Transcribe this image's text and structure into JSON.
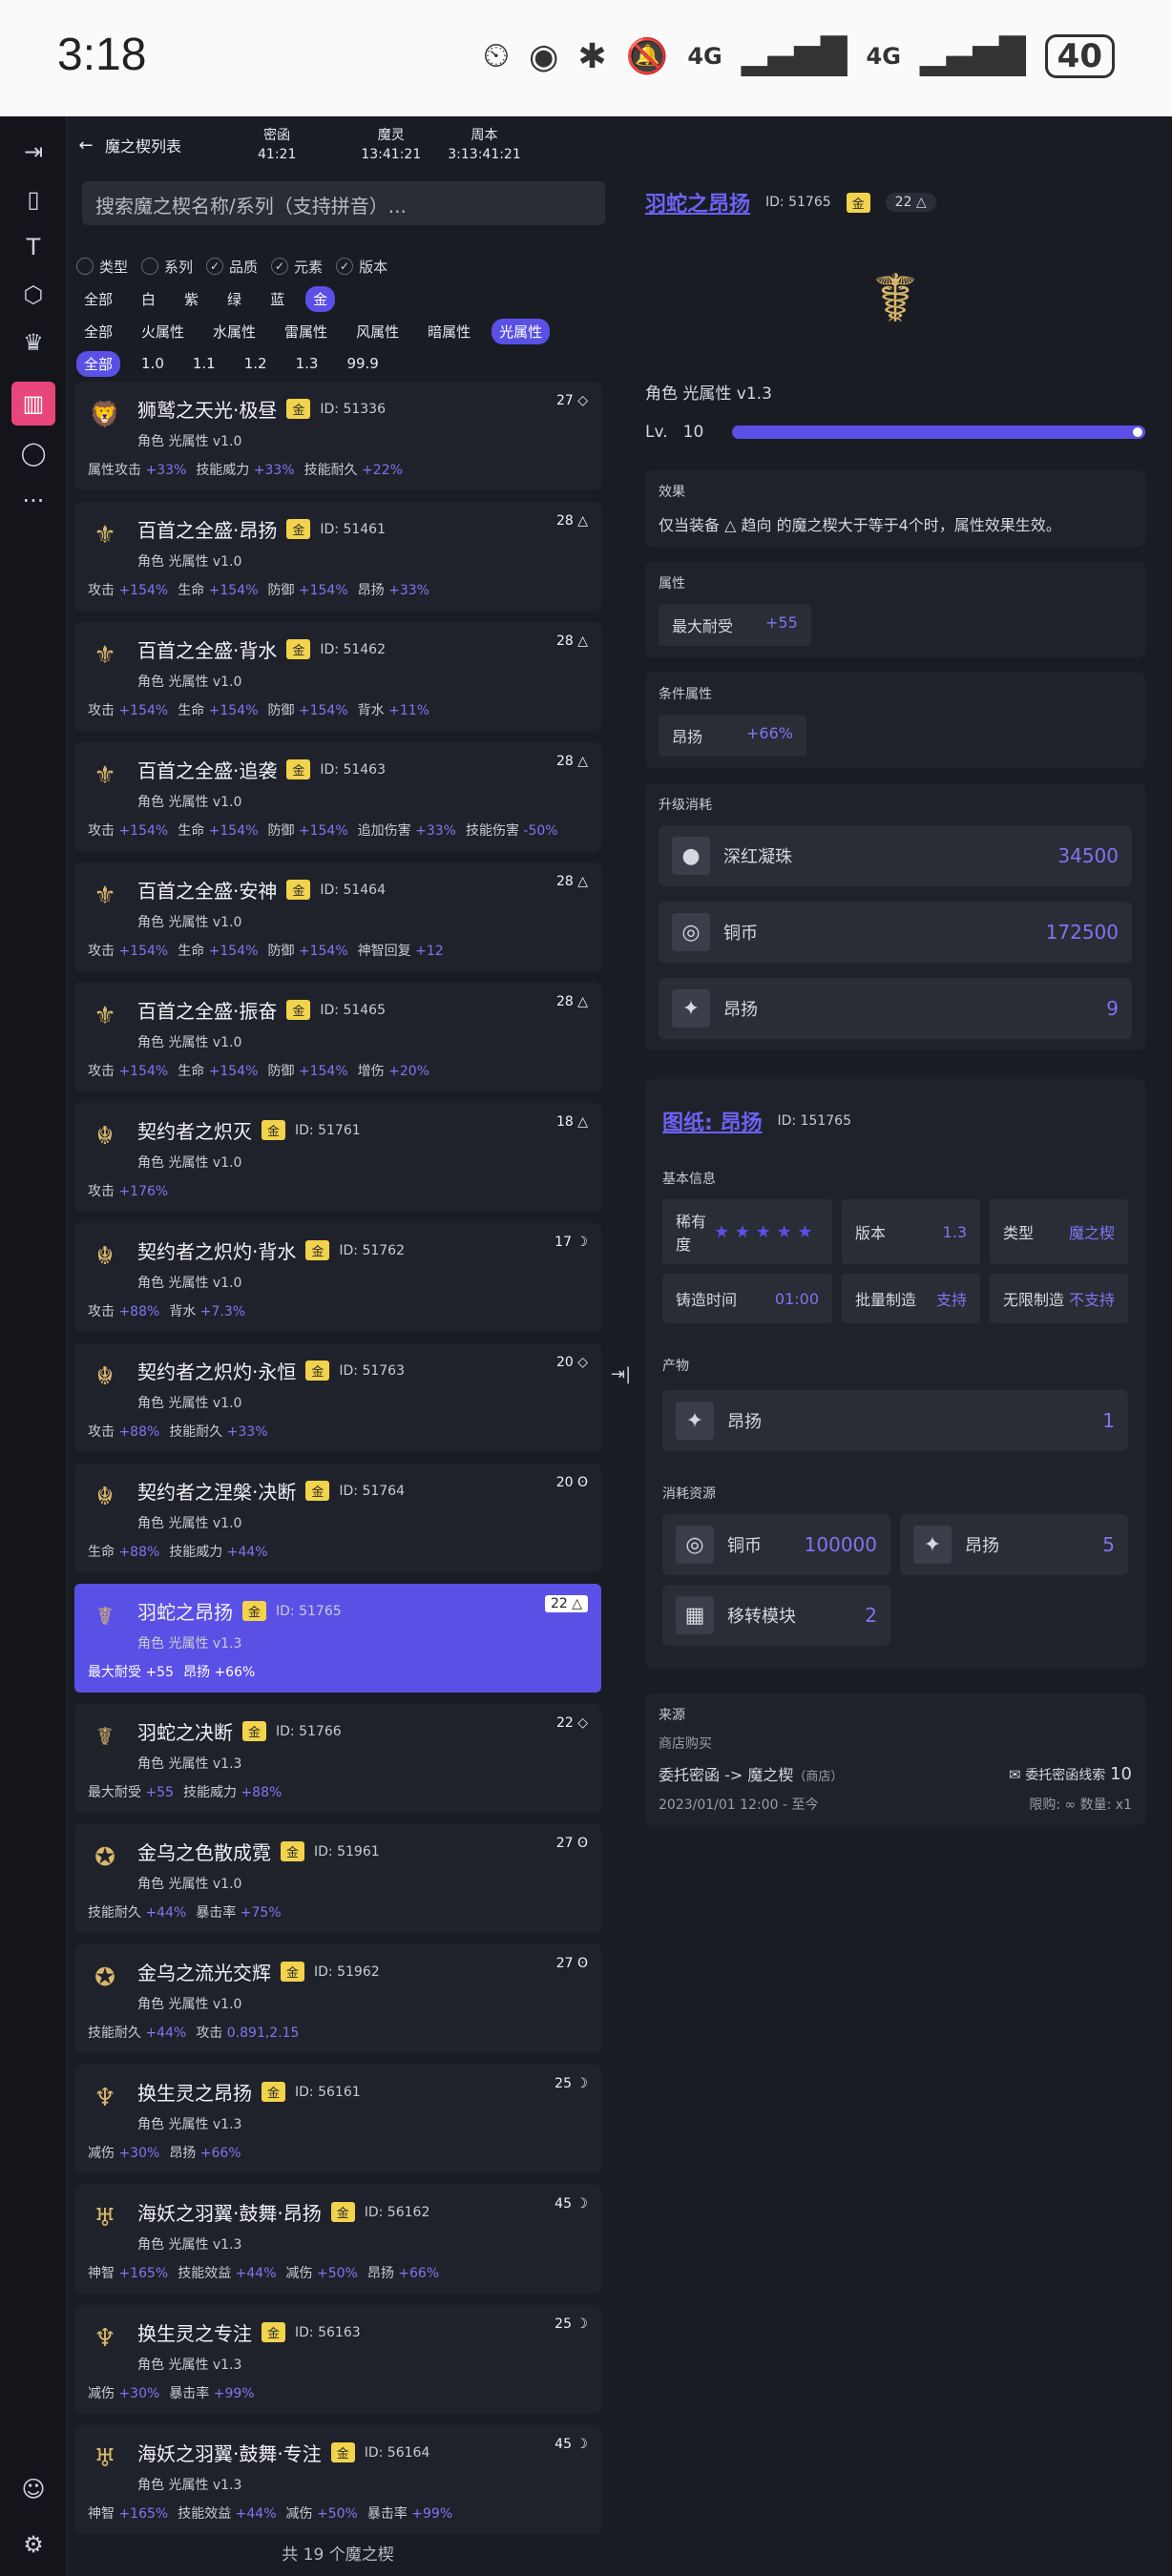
{
  "status": {
    "time": "3:18",
    "net1": "4G",
    "net2": "4G",
    "battery": "40"
  },
  "header": {
    "back": "←",
    "title": "魔之楔列表",
    "timers": [
      {
        "label": "密函",
        "value": "41:21"
      },
      {
        "label": "魔灵",
        "value": "13:41:21"
      },
      {
        "label": "周本",
        "value": "3:13:41:21"
      }
    ]
  },
  "search": {
    "placeholder": "搜索魔之楔名称/系列（支持拼音）..."
  },
  "filters": {
    "checks": [
      {
        "label": "类型",
        "on": false
      },
      {
        "label": "系列",
        "on": false
      },
      {
        "label": "品质",
        "on": true
      },
      {
        "label": "元素",
        "on": true
      },
      {
        "label": "版本",
        "on": true
      }
    ],
    "quality": [
      "全部",
      "白",
      "紫",
      "绿",
      "蓝",
      "金"
    ],
    "quality_sel": "金",
    "element": [
      "全部",
      "火属性",
      "水属性",
      "雷属性",
      "风属性",
      "暗属性",
      "光属性"
    ],
    "element_sel": "光属性",
    "version": [
      "全部",
      "1.0",
      "1.1",
      "1.2",
      "1.3",
      "99.9"
    ],
    "version_sel": "全部"
  },
  "list": [
    {
      "name": "狮鹫之天光·极昼",
      "q": "金",
      "id": "ID: 51336",
      "lv": "27 ◇",
      "meta": "角色  光属性  v1.0",
      "stats": [
        [
          "属性攻击",
          "+33%"
        ],
        [
          "技能威力",
          "+33%"
        ],
        [
          "技能耐久",
          "+22%"
        ]
      ]
    },
    {
      "name": "百首之全盛·昂扬",
      "q": "金",
      "id": "ID: 51461",
      "lv": "28 △",
      "meta": "角色  光属性  v1.0",
      "stats": [
        [
          "攻击",
          "+154%"
        ],
        [
          "生命",
          "+154%"
        ],
        [
          "防御",
          "+154%"
        ],
        [
          "昂扬",
          "+33%"
        ]
      ]
    },
    {
      "name": "百首之全盛·背水",
      "q": "金",
      "id": "ID: 51462",
      "lv": "28 △",
      "meta": "角色  光属性  v1.0",
      "stats": [
        [
          "攻击",
          "+154%"
        ],
        [
          "生命",
          "+154%"
        ],
        [
          "防御",
          "+154%"
        ],
        [
          "背水",
          "+11%"
        ]
      ]
    },
    {
      "name": "百首之全盛·追袭",
      "q": "金",
      "id": "ID: 51463",
      "lv": "28 △",
      "meta": "角色  光属性  v1.0",
      "stats": [
        [
          "攻击",
          "+154%"
        ],
        [
          "生命",
          "+154%"
        ],
        [
          "防御",
          "+154%"
        ],
        [
          "追加伤害",
          "+33%"
        ],
        [
          "技能伤害",
          "-50%"
        ]
      ]
    },
    {
      "name": "百首之全盛·安神",
      "q": "金",
      "id": "ID: 51464",
      "lv": "28 △",
      "meta": "角色  光属性  v1.0",
      "stats": [
        [
          "攻击",
          "+154%"
        ],
        [
          "生命",
          "+154%"
        ],
        [
          "防御",
          "+154%"
        ],
        [
          "神智回复",
          "+12"
        ]
      ]
    },
    {
      "name": "百首之全盛·振奋",
      "q": "金",
      "id": "ID: 51465",
      "lv": "28 △",
      "meta": "角色  光属性  v1.0",
      "stats": [
        [
          "攻击",
          "+154%"
        ],
        [
          "生命",
          "+154%"
        ],
        [
          "防御",
          "+154%"
        ],
        [
          "增伤",
          "+20%"
        ]
      ]
    },
    {
      "name": "契约者之炽灭",
      "q": "金",
      "id": "ID: 51761",
      "lv": "18 △",
      "meta": "角色  光属性  v1.0",
      "stats": [
        [
          "攻击",
          "+176%"
        ]
      ]
    },
    {
      "name": "契约者之炽灼·背水",
      "q": "金",
      "id": "ID: 51762",
      "lv": "17 ☽",
      "meta": "角色  光属性  v1.0",
      "stats": [
        [
          "攻击",
          "+88%"
        ],
        [
          "背水",
          "+7.3%"
        ]
      ]
    },
    {
      "name": "契约者之炽灼·永恒",
      "q": "金",
      "id": "ID: 51763",
      "lv": "20 ◇",
      "meta": "角色  光属性  v1.0",
      "stats": [
        [
          "攻击",
          "+88%"
        ],
        [
          "技能耐久",
          "+33%"
        ]
      ]
    },
    {
      "name": "契约者之涅槃·决断",
      "q": "金",
      "id": "ID: 51764",
      "lv": "20 ʘ",
      "meta": "角色  光属性  v1.0",
      "stats": [
        [
          "生命",
          "+88%"
        ],
        [
          "技能威力",
          "+44%"
        ]
      ]
    },
    {
      "name": "羽蛇之昂扬",
      "q": "金",
      "id": "ID: 51765",
      "lv": "22 △",
      "meta": "角色  光属性  v1.3",
      "stats": [
        [
          "最大耐受",
          "+55"
        ],
        [
          "昂扬",
          "+66%"
        ]
      ],
      "selected": true
    },
    {
      "name": "羽蛇之决断",
      "q": "金",
      "id": "ID: 51766",
      "lv": "22 ◇",
      "meta": "角色  光属性  v1.3",
      "stats": [
        [
          "最大耐受",
          "+55"
        ],
        [
          "技能威力",
          "+88%"
        ]
      ]
    },
    {
      "name": "金乌之色散成霓",
      "q": "金",
      "id": "ID: 51961",
      "lv": "27 ʘ",
      "meta": "角色  光属性  v1.0",
      "stats": [
        [
          "技能耐久",
          "+44%"
        ],
        [
          "暴击率",
          "+75%"
        ]
      ]
    },
    {
      "name": "金乌之流光交辉",
      "q": "金",
      "id": "ID: 51962",
      "lv": "27 ʘ",
      "meta": "角色  光属性  v1.0",
      "stats": [
        [
          "技能耐久",
          "+44%"
        ],
        [
          "攻击",
          "0.891,2.15"
        ]
      ]
    },
    {
      "name": "换生灵之昂扬",
      "q": "金",
      "id": "ID: 56161",
      "lv": "25 ☽",
      "meta": "角色  光属性  v1.3",
      "stats": [
        [
          "减伤",
          "+30%"
        ],
        [
          "昂扬",
          "+66%"
        ]
      ]
    },
    {
      "name": "海妖之羽翼·鼓舞·昂扬",
      "q": "金",
      "id": "ID: 56162",
      "lv": "45 ☽",
      "meta": "角色  光属性  v1.3",
      "stats": [
        [
          "神智",
          "+165%"
        ],
        [
          "技能效益",
          "+44%"
        ],
        [
          "减伤",
          "+50%"
        ],
        [
          "昂扬",
          "+66%"
        ]
      ]
    },
    {
      "name": "换生灵之专注",
      "q": "金",
      "id": "ID: 56163",
      "lv": "25 ☽",
      "meta": "角色  光属性  v1.3",
      "stats": [
        [
          "减伤",
          "+30%"
        ],
        [
          "暴击率",
          "+99%"
        ]
      ]
    },
    {
      "name": "海妖之羽翼·鼓舞·专注",
      "q": "金",
      "id": "ID: 56164",
      "lv": "45 ☽",
      "meta": "角色  光属性  v1.3",
      "stats": [
        [
          "神智",
          "+165%"
        ],
        [
          "技能效益",
          "+44%"
        ],
        [
          "减伤",
          "+50%"
        ],
        [
          "暴击率",
          "+99%"
        ]
      ]
    }
  ],
  "count_text": "共 19 个魔之楔",
  "detail": {
    "title": "羽蛇之昂扬",
    "id": "ID: 51765",
    "quality": "金",
    "level_tag": "22 △",
    "meta": "角色  光属性  v1.3",
    "lv_label": "Lv.",
    "lv": "10",
    "lv_fraction": 1.0,
    "effect_label": "效果",
    "effect": "仅当装备 △ 趋向 的魔之楔大于等于4个时，属性效果生效。",
    "attr_label": "属性",
    "attr": {
      "k": "最大耐受",
      "v": "+55"
    },
    "cond_label": "条件属性",
    "cond": {
      "k": "昂扬",
      "v": "+66%"
    },
    "upgrade_label": "升级消耗",
    "upgrade": [
      {
        "icon": "●",
        "name": "深红凝珠",
        "amt": "34500"
      },
      {
        "icon": "◎",
        "name": "铜币",
        "amt": "172500"
      },
      {
        "icon": "✦",
        "name": "昂扬",
        "amt": "9"
      }
    ]
  },
  "recipe": {
    "title": "图纸: 昂扬",
    "id": "ID: 151765",
    "basic_label": "基本信息",
    "rarity_label": "稀有度",
    "rarity_stars": "★ ★ ★ ★ ★",
    "version_label": "版本",
    "version": "1.3",
    "type_label": "类型",
    "type": "魔之楔",
    "time_label": "铸造时间",
    "time": "01:00",
    "batch_label": "批量制造",
    "batch": "支持",
    "unlimited_label": "无限制造",
    "unlimited": "不支持",
    "product_label": "产物",
    "product": {
      "name": "昂扬",
      "amt": "1"
    },
    "consume_label": "消耗资源",
    "consume": [
      {
        "icon": "◎",
        "name": "铜币",
        "amt": "100000"
      },
      {
        "icon": "✦",
        "name": "昂扬",
        "amt": "5"
      },
      {
        "icon": "▦",
        "name": "移转模块",
        "amt": "2"
      }
    ]
  },
  "source": {
    "label": "来源",
    "sub": "商店购买",
    "path": "委托密函 -> 魔之楔",
    "shop": "（商店）",
    "cost_label": "委托密函线索",
    "cost": "10",
    "dates": "2023/01/01 12:00 - 至今",
    "limit": "限购: ∞ 数量: x1"
  }
}
